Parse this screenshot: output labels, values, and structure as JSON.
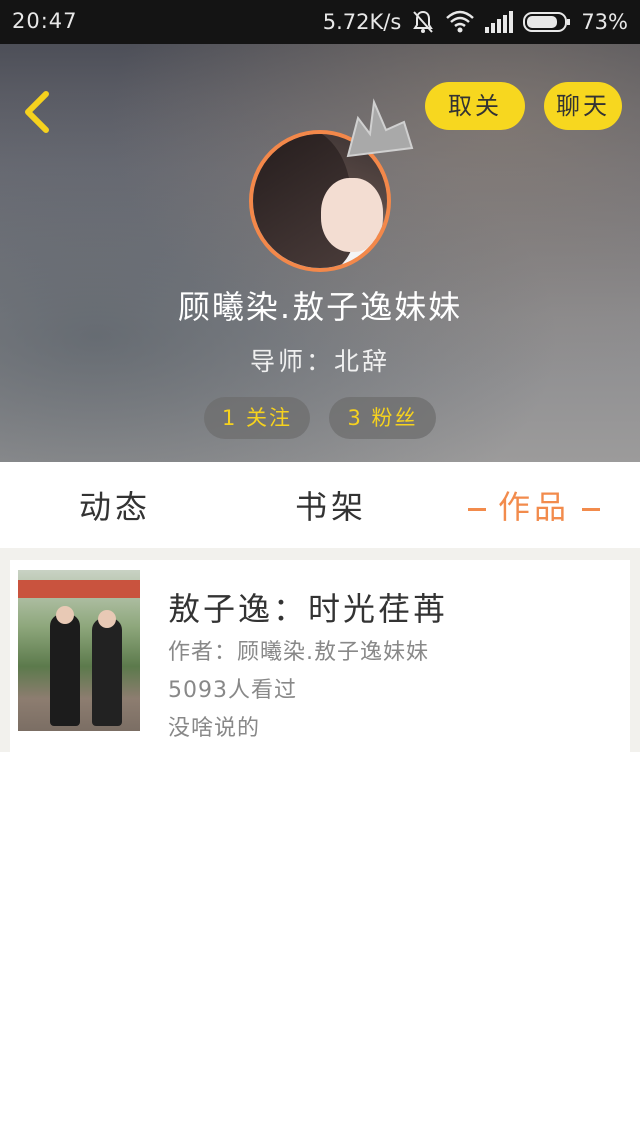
{
  "status_bar": {
    "time": "20:47",
    "network_speed": "5.72K/s",
    "battery": "73%",
    "icons": [
      "mute-bell-icon",
      "wifi-icon",
      "signal-icon",
      "battery-icon"
    ]
  },
  "header": {
    "back_icon": "chevron-left-icon",
    "unfollow_label": "取关",
    "chat_label": "聊天",
    "crown_icon": "crown-icon",
    "username": "顾曦染.敖子逸妹妹",
    "mentor": "导师：北辞",
    "following": "1 关注",
    "fans": "3 粉丝"
  },
  "tabs": [
    {
      "label": "动态",
      "active": false
    },
    {
      "label": "书架",
      "active": false
    },
    {
      "label": "作品",
      "active": true
    }
  ],
  "works": [
    {
      "title": "敖子逸：时光荏苒",
      "author": "作者：顾曦染.敖子逸妹妹",
      "views": "5093人看过",
      "description": "没啥说的"
    }
  ],
  "colors": {
    "accent_yellow": "#f7d71f",
    "accent_orange": "#f28b4c",
    "stat_text": "#f6d21e"
  }
}
